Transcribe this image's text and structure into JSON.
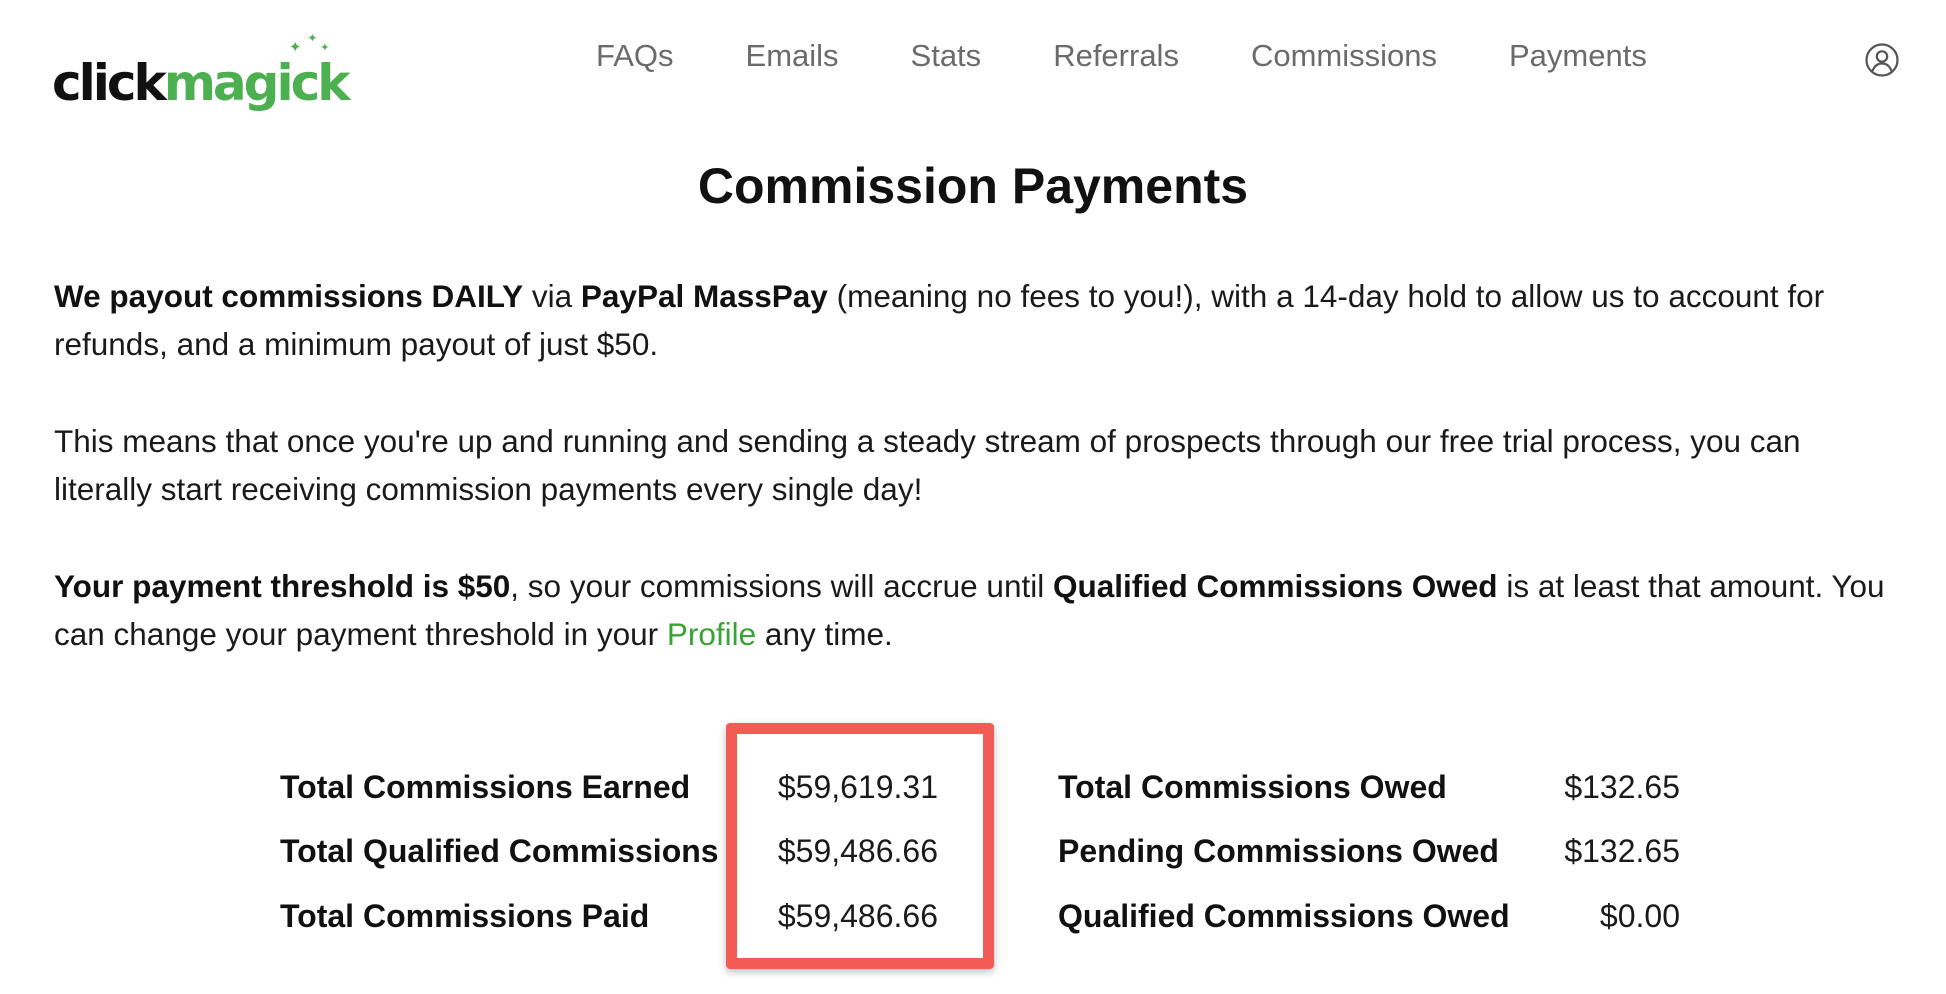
{
  "brand": {
    "logo_part1": "click",
    "logo_part2": "magick",
    "accent_color": "#4caf50"
  },
  "nav": {
    "items": [
      "FAQs",
      "Emails",
      "Stats",
      "Referrals",
      "Commissions",
      "Payments"
    ],
    "profile_icon": "user-circle-icon"
  },
  "page": {
    "title": "Commission Payments"
  },
  "paragraphs": {
    "p1": {
      "bold1": "We payout commissions DAILY",
      "text1": " via ",
      "bold2": "PayPal MassPay",
      "text2": " (meaning no fees to you!), with a 14-day hold to allow us to account for refunds, and a minimum payout of just $50."
    },
    "p2": "This means that once you're up and running and sending a steady stream of prospects through our free trial process, you can literally start receiving commission payments every single day!",
    "p3": {
      "bold1": "Your payment threshold is $50",
      "text1": ", so your commissions will accrue until ",
      "bold2": "Qualified Commissions Owed",
      "text2": " is at least that amount. You can change your payment threshold in your ",
      "link": "Profile",
      "text3": " any time.",
      "link_color": "#3aa335"
    }
  },
  "stats": {
    "left": [
      {
        "label": "Total Commissions Earned",
        "value": "$59,619.31"
      },
      {
        "label": "Total Qualified Commissions",
        "value": "$59,486.66"
      },
      {
        "label": "Total Commissions Paid",
        "value": "$59,486.66"
      }
    ],
    "right": [
      {
        "label": "Total Commissions Owed",
        "value": "$132.65"
      },
      {
        "label": "Pending Commissions Owed",
        "value": "$132.65"
      },
      {
        "label": "Qualified Commissions Owed",
        "value": "$0.00"
      }
    ],
    "highlight_color": "#f25c54"
  }
}
